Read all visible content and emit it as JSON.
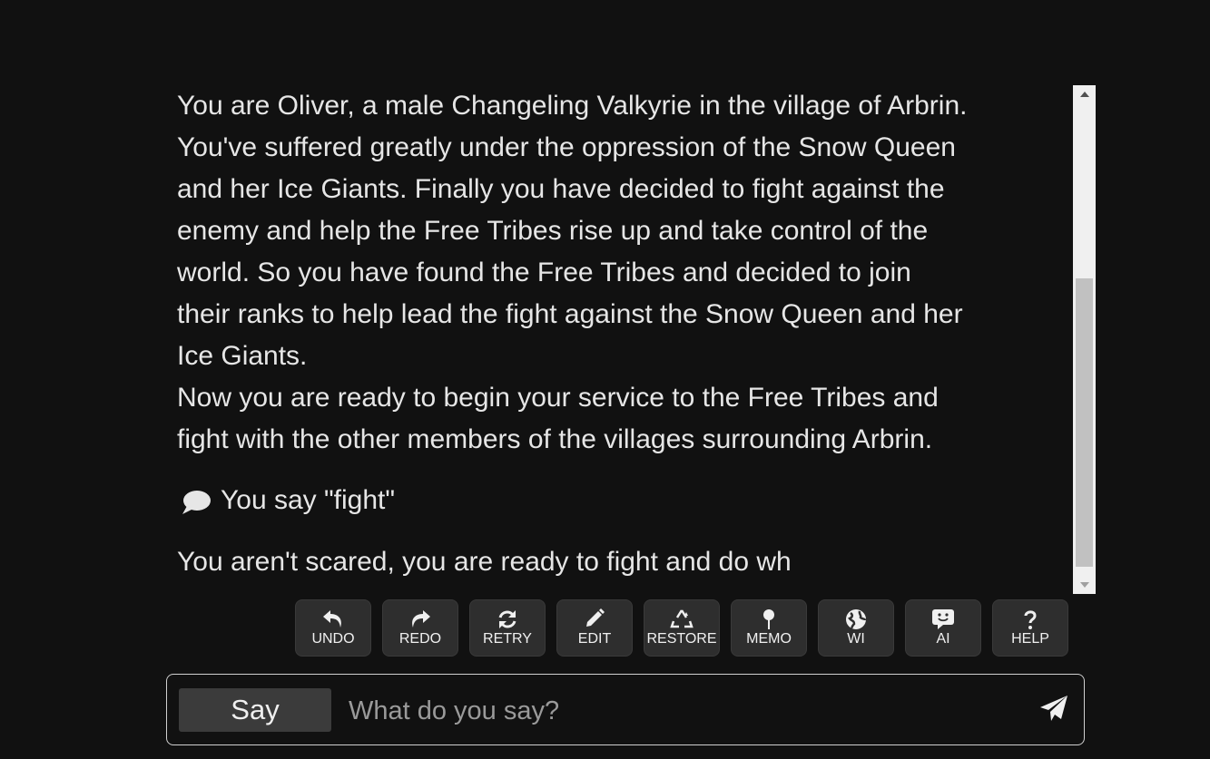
{
  "story": {
    "intro_lines": [
      "You are Oliver, a male Changeling Valkyrie in the village of Arbrin.",
      "You've suffered greatly under the oppression of the Snow Queen",
      "and her Ice Giants. Finally you have decided to fight against the",
      "enemy and help the Free Tribes rise up and take control of the",
      "world. So you have found the Free Tribes and decided to join",
      "their ranks to help lead the fight against the Snow Queen and her",
      "Ice Giants."
    ],
    "ready_lines": [
      "Now you are ready to begin your service to the Free Tribes and",
      "fight with the other members of the villages surrounding Arbrin."
    ],
    "action_text": "You say \"fight\"",
    "action_icon": "speech-bubble-icon",
    "continuation": "You aren't scared, you are ready to fight and do wh"
  },
  "toolbar": {
    "buttons": [
      {
        "label": "UNDO",
        "icon": "undo-icon"
      },
      {
        "label": "REDO",
        "icon": "redo-icon"
      },
      {
        "label": "RETRY",
        "icon": "retry-icon"
      },
      {
        "label": "EDIT",
        "icon": "pencil-icon"
      },
      {
        "label": "RESTORE",
        "icon": "recycle-icon"
      },
      {
        "label": "MEMO",
        "icon": "pin-icon"
      },
      {
        "label": "WI",
        "icon": "globe-icon"
      },
      {
        "label": "AI",
        "icon": "ai-chat-icon"
      },
      {
        "label": "HELP",
        "icon": "question-icon"
      }
    ]
  },
  "input": {
    "mode_label": "Say",
    "placeholder": "What do you say?",
    "value": "",
    "send_icon": "send-icon"
  },
  "colors": {
    "background": "#111111",
    "text": "#e6e6e6",
    "button_bg": "#2e2e2e",
    "say_button_bg": "#3b3b3b"
  }
}
